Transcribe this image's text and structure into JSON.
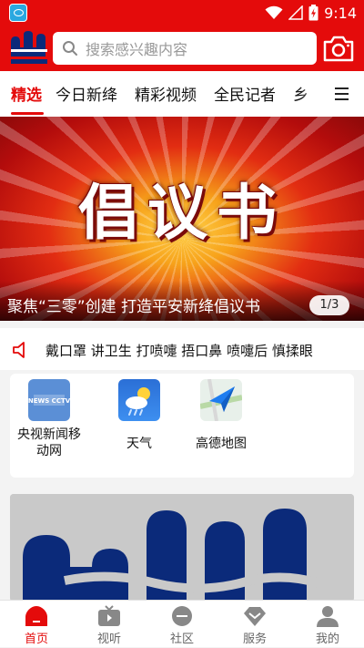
{
  "status_bar": {
    "time": "9:14"
  },
  "header": {
    "search_placeholder": "搜索感兴趣内容"
  },
  "tabs": [
    {
      "label": "精选",
      "active": true
    },
    {
      "label": "今日新绛"
    },
    {
      "label": "精彩视频"
    },
    {
      "label": "全民记者"
    },
    {
      "label": "乡"
    }
  ],
  "banner": {
    "title_art": "倡议书",
    "caption": "聚焦“三零”创建 打造平安新绛倡议书",
    "counter": "1/3"
  },
  "notice": {
    "text": "戴口罩 讲卫生 打喷嚏 捂口鼻 喷嚏后 慎揉眼"
  },
  "apps": [
    {
      "label_line1": "央视新闻移",
      "label_line2": "动网",
      "icon": "cctv-news-icon"
    },
    {
      "label_line1": "天气",
      "icon": "weather-icon"
    },
    {
      "label_line1": "高德地图",
      "icon": "amap-icon"
    }
  ],
  "bottom_nav": [
    {
      "label": "首页",
      "icon": "home-icon",
      "active": true
    },
    {
      "label": "视听",
      "icon": "tv-icon"
    },
    {
      "label": "社区",
      "icon": "community-icon"
    },
    {
      "label": "服务",
      "icon": "service-icon"
    },
    {
      "label": "我的",
      "icon": "profile-icon"
    }
  ],
  "colors": {
    "brand_red": "#e40b0b",
    "navy": "#0b2a7a"
  }
}
